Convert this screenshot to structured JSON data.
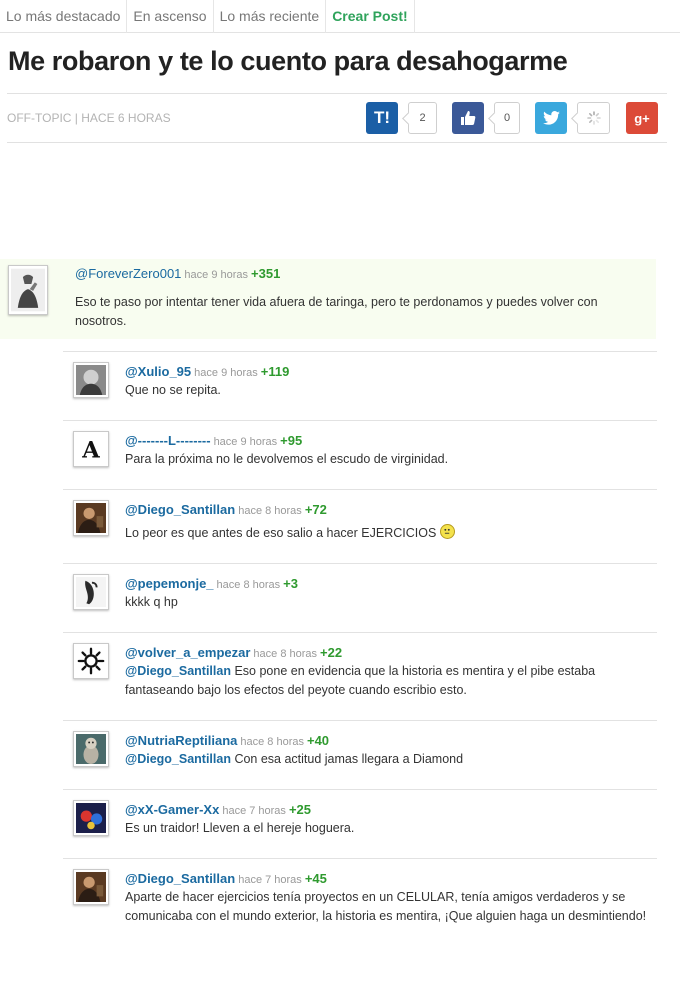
{
  "tabs": [
    "Lo más destacado",
    "En ascenso",
    "Lo más reciente",
    "Crear Post!"
  ],
  "post": {
    "title": "Me robaron y te lo cuento para desahogarme",
    "category": "OFF-TOPIC",
    "time": "HACE 6 HORAS"
  },
  "share": {
    "taringa_label": "T!",
    "taringa_count": "2",
    "like_count": "0",
    "gplus_label": "g+"
  },
  "comments": [
    {
      "user": "@ForeverZero001",
      "time": "hace 9 horas",
      "votes": "+351",
      "mention": "",
      "text": "Eso te paso por intentar tener vida afuera de taringa, pero te perdonamos y puedes volver con nosotros."
    },
    {
      "user": "@Xulio_95",
      "time": "hace 9 horas",
      "votes": "+119",
      "mention": "",
      "text": "Que no se repita."
    },
    {
      "user": "@-------L--------",
      "time": "hace 9 horas",
      "votes": "+95",
      "mention": "",
      "text": "Para la próxima no le devolvemos el escudo de virginidad."
    },
    {
      "user": "@Diego_Santillan",
      "time": "hace 8 horas",
      "votes": "+72",
      "mention": "",
      "text": "Lo peor es que antes de eso salio a hacer EJERCICIOS"
    },
    {
      "user": "@pepemonje_",
      "time": "hace 8 horas",
      "votes": "+3",
      "mention": "",
      "text": "kkkk q hp"
    },
    {
      "user": "@volver_a_empezar",
      "time": "hace 8 horas",
      "votes": "+22",
      "mention": "@Diego_Santillan",
      "text": "Eso pone en evidencia que la historia es mentira y el pibe estaba fantaseando bajo los efectos del peyote cuando escribio esto."
    },
    {
      "user": "@NutriaReptiliana",
      "time": "hace 8 horas",
      "votes": "+40",
      "mention": "@Diego_Santillan",
      "text": "Con esa actitud jamas llegara a Diamond"
    },
    {
      "user": "@xX-Gamer-Xx",
      "time": "hace 7 horas",
      "votes": "+25",
      "mention": "",
      "text": "Es un traidor! Lleven a el hereje hoguera."
    },
    {
      "user": "@Diego_Santillan",
      "time": "hace 7 horas",
      "votes": "+45",
      "mention": "",
      "text": "Aparte de hacer ejercicios tenía proyectos en un CELULAR, tenía amigos verdaderos y se comunicaba con el mundo exterior, la historia es mentira, ¡Que alguien haga un desmintiendo!"
    }
  ]
}
